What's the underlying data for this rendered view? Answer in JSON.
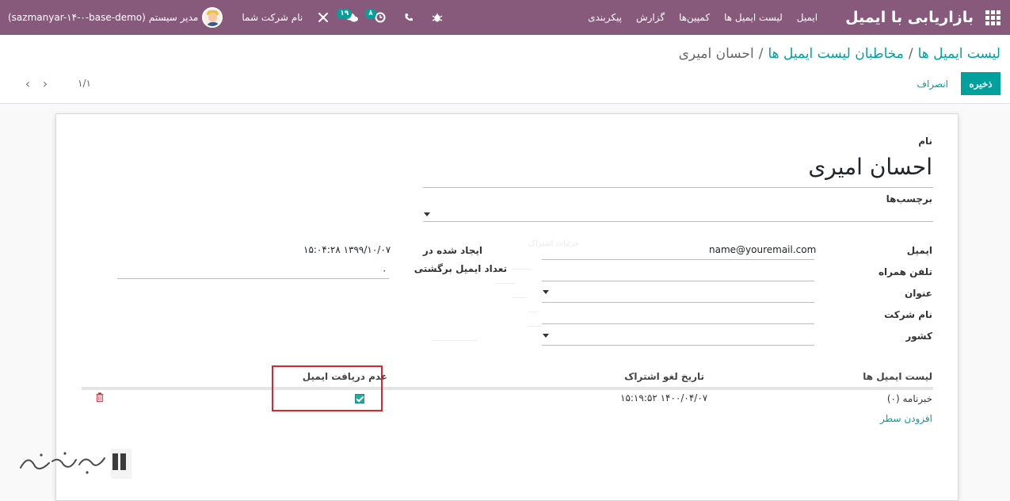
{
  "navbar": {
    "brand": "بازاریابی با ایمیل",
    "menu": [
      "ایمیل",
      "لیست ایمیل ها",
      "کمپین‌ها",
      "گزارش",
      "پیکربندی"
    ],
    "company": "نام شرکت شما",
    "user": "مدیر سیستم",
    "database": "(sazmanyar-۱۴-۰-base-demo)",
    "activity_badge": "۸",
    "messages_badge": "۱۹",
    "icons": [
      "apps-grid-icon",
      "bug-icon",
      "phone-icon",
      "clock-icon",
      "chat-icon",
      "tools-icon"
    ]
  },
  "breadcrumb": {
    "items": [
      "لیست ایمیل ها",
      "مخاطبان لیست ایمیل ها"
    ],
    "current": "احسان امیری",
    "separator": "/"
  },
  "controls": {
    "save_label": "ذخیره",
    "discard_label": "انصراف",
    "pager_value": "۱/۱"
  },
  "form": {
    "name_label": "نام",
    "name_value": "احسان امیری",
    "tags_label": "برچسب‌ها",
    "email_label": "ایمیل",
    "email_value": "name@youremail.com",
    "mobile_label": "تلفن همراه",
    "title_label": "عنوان",
    "company_label": "نام شرکت",
    "country_label": "کشور",
    "created_label": "ایجاد شده در",
    "created_value": "۱۵:۰۴:۲۸ ۱۳۹۹/۱۰/۰۷",
    "bounce_label": "تعداد ایمیل برگشتی",
    "bounce_value": "۰"
  },
  "subscriptions": {
    "columns": [
      "لیست ایمیل ها",
      "تاریخ لغو اشتراک",
      "عدم دریافت ایمیل"
    ],
    "rows": [
      {
        "list": "خبرنامه (۰)",
        "unsub_date": "۱۵:۱۹:۵۲ ۱۴۰۰/۰۴/۰۷",
        "opt_out": true
      }
    ],
    "add_line": "افزودن سطر"
  },
  "colors": {
    "navbar": "#875a7b",
    "accent": "#00a09d",
    "highlight": "#d7282f"
  }
}
